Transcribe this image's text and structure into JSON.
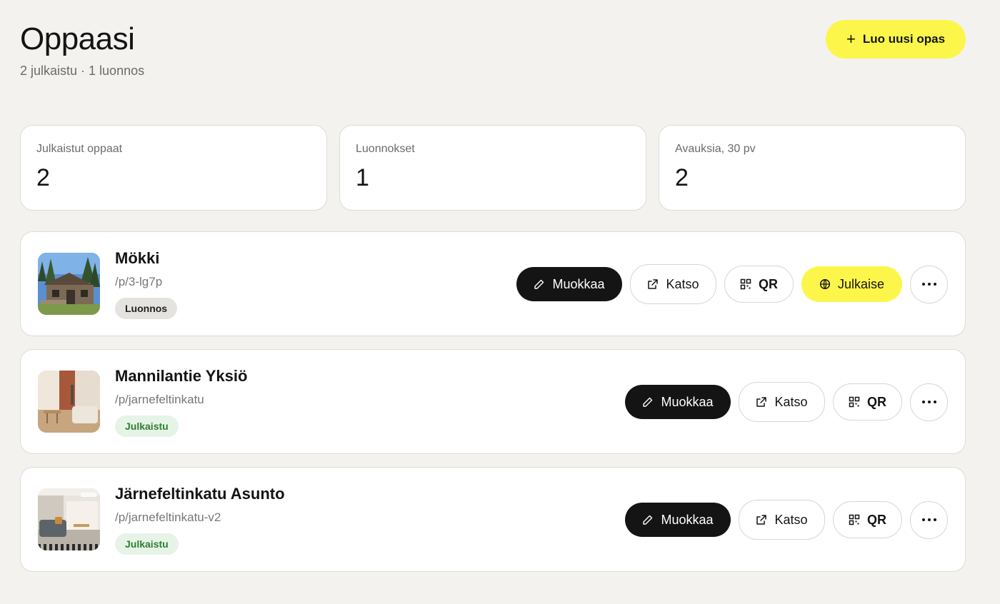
{
  "header": {
    "title": "Oppaasi",
    "subtitle": "2 julkaistu · 1 luonnos",
    "create_label": "Luo uusi opas"
  },
  "stats": [
    {
      "label": "Julkaistut oppaat",
      "value": "2"
    },
    {
      "label": "Luonnokset",
      "value": "1"
    },
    {
      "label": "Avauksia, 30 pv",
      "value": "2"
    }
  ],
  "guides": [
    {
      "title": "Mökki",
      "slug": "/p/3-lg7p",
      "status": "Luonnos"
    },
    {
      "title": "Mannilantie Yksiö",
      "slug": "/p/jarnefeltinkatu",
      "status": "Julkaistu"
    },
    {
      "title": "Järnefeltinkatu Asunto",
      "slug": "/p/jarnefeltinkatu-v2",
      "status": "Julkaistu"
    }
  ],
  "actions": {
    "edit_label": "Muokkaa",
    "view_label": "Katso",
    "qr_label": "QR",
    "publish_label": "Julkaise"
  },
  "colors": {
    "accent_yellow": "#fcf64a",
    "dark": "#141414",
    "published_bg": "#e6f4e7",
    "published_text": "#2e7d32",
    "draft_bg": "#e5e3df"
  },
  "icons": [
    "plus-icon",
    "pencil-icon",
    "external-link-icon",
    "qr-code-icon",
    "globe-icon",
    "more-horizontal-icon"
  ]
}
